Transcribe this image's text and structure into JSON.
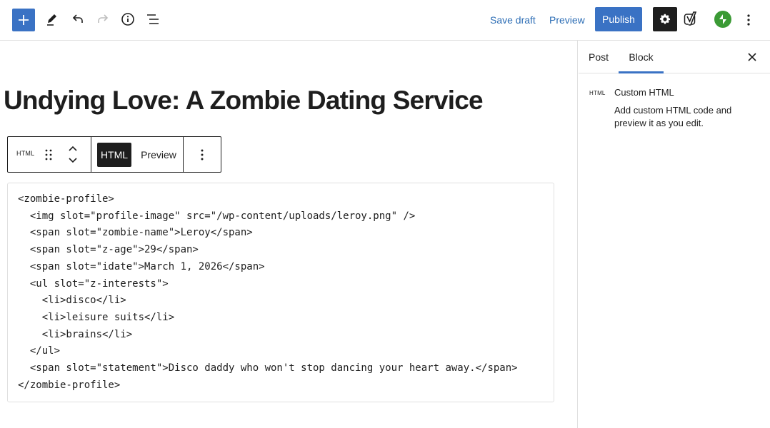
{
  "toolbar": {
    "save_draft": "Save draft",
    "preview": "Preview",
    "publish": "Publish"
  },
  "colors": {
    "accent": "#3a72c4",
    "dark": "#1e1e1e",
    "jetpack": "#3b9a35",
    "link": "#2c6db5"
  },
  "icons": {
    "add": "plus-icon",
    "tools": "pencil-icon",
    "undo": "undo-icon",
    "redo": "redo-icon",
    "details": "info-icon",
    "outline": "list-view-icon",
    "settings": "gear-icon",
    "yoast": "yoast-icon",
    "jetpack": "jetpack-icon",
    "options": "kebab-icon"
  },
  "post": {
    "title": "Undying Love: A Zombie Dating Service"
  },
  "block_toolbar": {
    "type_label": "HTML",
    "html_tab": "HTML",
    "preview_tab": "Preview"
  },
  "code": {
    "lines": [
      "<zombie-profile>",
      "  <img slot=\"profile-image\" src=\"/wp-content/uploads/leroy.png\" />",
      "  <span slot=\"zombie-name\">Leroy</span>",
      "  <span slot=\"z-age\">29</span>",
      "  <span slot=\"idate\">March 1, 2026</span>",
      "  <ul slot=\"z-interests\">",
      "    <li>disco</li>",
      "    <li>leisure suits</li>",
      "    <li>brains</li>",
      "  </ul>",
      "  <span slot=\"statement\">Disco daddy who won't stop dancing your heart away.</span>",
      "</zombie-profile>"
    ]
  },
  "sidebar": {
    "tab_post": "Post",
    "tab_block": "Block",
    "block_icon_label": "HTML",
    "block_title": "Custom HTML",
    "block_description": "Add custom HTML code and preview it as you edit."
  }
}
